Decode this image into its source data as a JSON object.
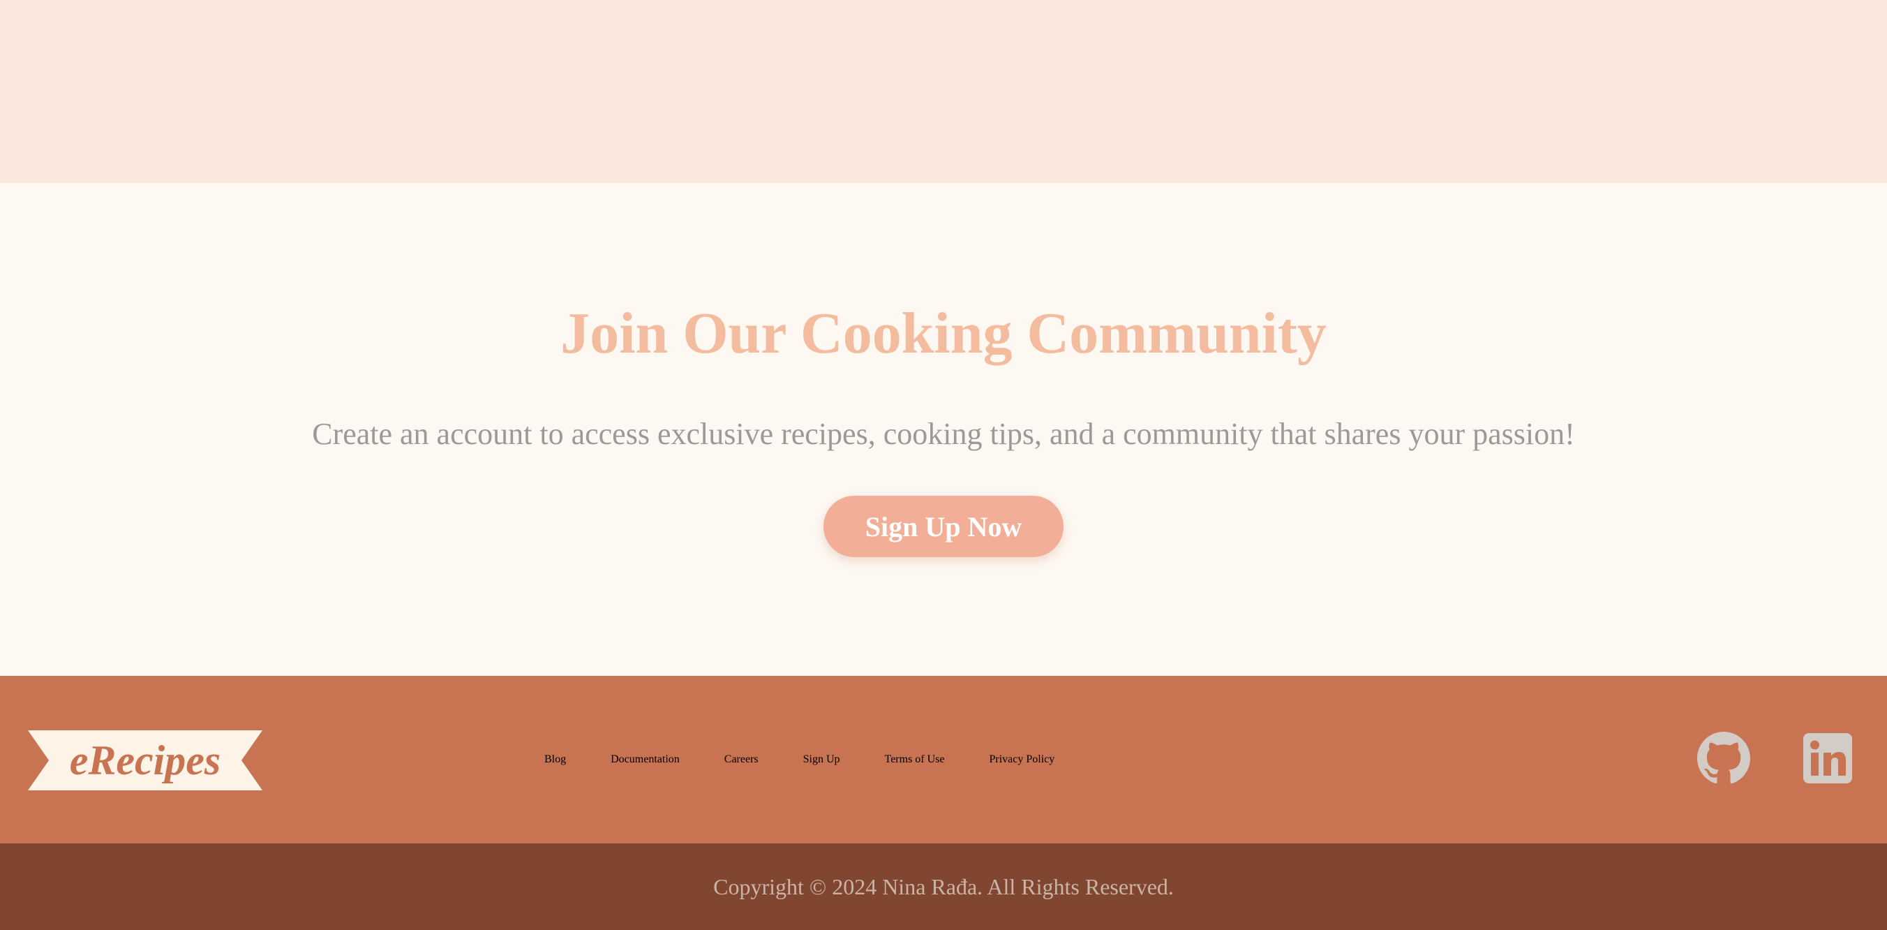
{
  "cta": {
    "title": "Join Our Cooking Community",
    "subtitle": "Create an account to access exclusive recipes, cooking tips, and a community that shares your passion!",
    "button_label": "Sign Up Now"
  },
  "footer": {
    "logo_text": "eRecipes",
    "links": [
      "Blog",
      "Documentation",
      "Careers",
      "Sign Up",
      "Terms of Use",
      "Privacy Policy"
    ],
    "social": [
      "github-icon",
      "linkedin-icon"
    ],
    "copyright": "Copyright © 2024 Nina Rađa. All Rights Reserved."
  },
  "colors": {
    "top_band": "#fae8de",
    "cta_background": "#fdf8f2",
    "title": "#f4bc9e",
    "button": "#f2ae96",
    "footer": "#c87352",
    "footer_bottom": "#81462f"
  }
}
